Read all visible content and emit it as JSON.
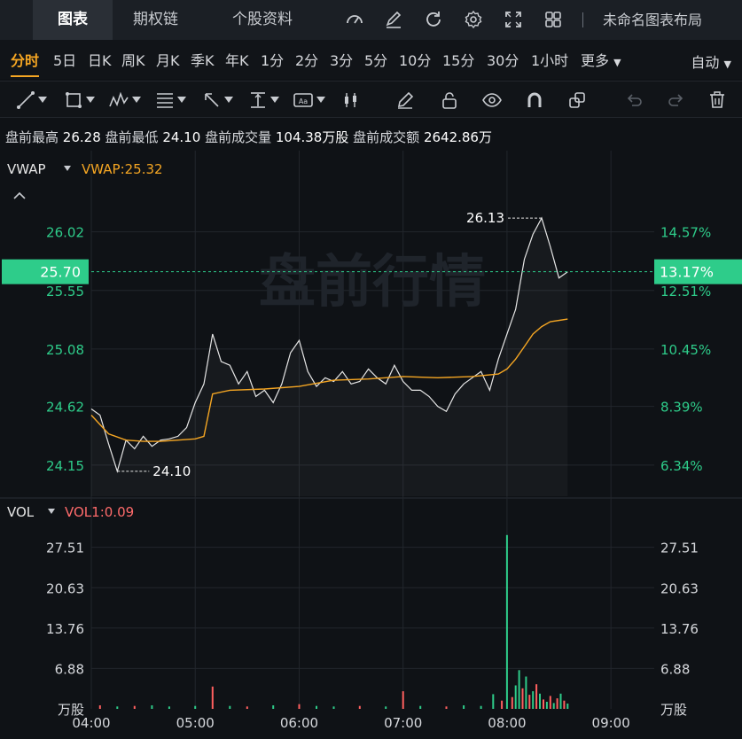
{
  "tabs": [
    {
      "label": "图表",
      "active": true
    },
    {
      "label": "期权链",
      "active": false
    },
    {
      "label": "个股资料",
      "active": false
    }
  ],
  "layout_name": "未命名图表布局",
  "periods": [
    "分时",
    "5日",
    "日K",
    "周K",
    "月K",
    "季K",
    "年K",
    "1分",
    "2分",
    "3分",
    "5分",
    "10分",
    "15分",
    "30分",
    "1小时",
    "更多"
  ],
  "active_period": "分时",
  "auto_label": "自动",
  "info": {
    "high_label": "盘前最高",
    "high_value": "26.28",
    "low_label": "盘前最低",
    "low_value": "24.10",
    "vol_label": "盘前成交量",
    "vol_value": "104.38万股",
    "amt_label": "盘前成交额",
    "amt_value": "2642.86万"
  },
  "watermark": "盘前行情",
  "colors": {
    "up": "#2ecc8a",
    "down": "#ff5f5f",
    "vwap": "#f5a623",
    "price": "#e6e6e6",
    "price_tag_bg": "#2ecc8a"
  },
  "chart_data": {
    "type": "line",
    "price_panel": {
      "indicator_name": "VWAP",
      "indicator_value": "VWAP:25.32",
      "left_ticks": [
        "26.02",
        "25.55",
        "25.08",
        "24.62",
        "24.15"
      ],
      "right_ticks": [
        "14.57%",
        "12.51%",
        "10.45%",
        "8.39%",
        "6.34%"
      ],
      "current_price": "25.70",
      "current_pct": "13.17%",
      "high_annotation": "26.13",
      "low_annotation": "24.10",
      "ylim": [
        23.9,
        26.6
      ],
      "price_series": [
        [
          "04:00",
          24.6
        ],
        [
          "04:05",
          24.55
        ],
        [
          "04:10",
          24.32
        ],
        [
          "04:15",
          24.1
        ],
        [
          "04:20",
          24.35
        ],
        [
          "04:25",
          24.28
        ],
        [
          "04:30",
          24.38
        ],
        [
          "04:35",
          24.3
        ],
        [
          "04:40",
          24.35
        ],
        [
          "04:45",
          24.36
        ],
        [
          "04:50",
          24.38
        ],
        [
          "04:55",
          24.45
        ],
        [
          "05:00",
          24.65
        ],
        [
          "05:05",
          24.8
        ],
        [
          "05:10",
          25.2
        ],
        [
          "05:15",
          24.98
        ],
        [
          "05:20",
          24.95
        ],
        [
          "05:25",
          24.8
        ],
        [
          "05:30",
          24.9
        ],
        [
          "05:35",
          24.7
        ],
        [
          "05:40",
          24.75
        ],
        [
          "05:45",
          24.65
        ],
        [
          "05:50",
          24.8
        ],
        [
          "05:55",
          25.05
        ],
        [
          "06:00",
          25.15
        ],
        [
          "06:05",
          24.9
        ],
        [
          "06:10",
          24.78
        ],
        [
          "06:15",
          24.85
        ],
        [
          "06:20",
          24.82
        ],
        [
          "06:25",
          24.9
        ],
        [
          "06:30",
          24.8
        ],
        [
          "06:35",
          24.82
        ],
        [
          "06:40",
          24.92
        ],
        [
          "06:45",
          24.85
        ],
        [
          "06:50",
          24.8
        ],
        [
          "06:55",
          24.95
        ],
        [
          "07:00",
          24.82
        ],
        [
          "07:05",
          24.75
        ],
        [
          "07:10",
          24.75
        ],
        [
          "07:15",
          24.7
        ],
        [
          "07:20",
          24.62
        ],
        [
          "07:25",
          24.58
        ],
        [
          "07:30",
          24.72
        ],
        [
          "07:35",
          24.8
        ],
        [
          "07:40",
          24.85
        ],
        [
          "07:45",
          24.9
        ],
        [
          "07:50",
          24.75
        ],
        [
          "07:55",
          25.0
        ],
        [
          "08:00",
          25.2
        ],
        [
          "08:05",
          25.4
        ],
        [
          "08:10",
          25.8
        ],
        [
          "08:15",
          26.0
        ],
        [
          "08:20",
          26.13
        ],
        [
          "08:25",
          25.9
        ],
        [
          "08:30",
          25.65
        ],
        [
          "08:35",
          25.7
        ]
      ],
      "vwap_series": [
        [
          "04:00",
          24.55
        ],
        [
          "04:10",
          24.4
        ],
        [
          "04:20",
          24.35
        ],
        [
          "04:30",
          24.34
        ],
        [
          "04:40",
          24.34
        ],
        [
          "04:50",
          24.35
        ],
        [
          "05:00",
          24.36
        ],
        [
          "05:05",
          24.38
        ],
        [
          "05:10",
          24.72
        ],
        [
          "05:20",
          24.75
        ],
        [
          "05:40",
          24.76
        ],
        [
          "06:00",
          24.78
        ],
        [
          "06:20",
          24.83
        ],
        [
          "06:40",
          24.84
        ],
        [
          "07:00",
          24.86
        ],
        [
          "07:20",
          24.85
        ],
        [
          "07:40",
          24.86
        ],
        [
          "07:55",
          24.88
        ],
        [
          "08:00",
          24.92
        ],
        [
          "08:05",
          25.0
        ],
        [
          "08:10",
          25.1
        ],
        [
          "08:15",
          25.2
        ],
        [
          "08:20",
          25.26
        ],
        [
          "08:25",
          25.3
        ],
        [
          "08:35",
          25.32
        ]
      ]
    },
    "volume_panel": {
      "indicator_name": "VOL",
      "indicator_value": "VOL1:0.09",
      "ticks": [
        "27.51",
        "20.63",
        "13.76",
        "6.88"
      ],
      "unit": "万股",
      "ylim": [
        0,
        34.4
      ],
      "bars": [
        [
          "04:05",
          0.6,
          "down"
        ],
        [
          "04:15",
          0.4,
          "up"
        ],
        [
          "04:25",
          0.5,
          "down"
        ],
        [
          "04:35",
          0.6,
          "up"
        ],
        [
          "04:45",
          0.4,
          "up"
        ],
        [
          "05:00",
          0.5,
          "up"
        ],
        [
          "05:10",
          3.8,
          "down"
        ],
        [
          "05:20",
          0.5,
          "up"
        ],
        [
          "05:30",
          0.4,
          "down"
        ],
        [
          "05:45",
          0.6,
          "up"
        ],
        [
          "06:00",
          0.8,
          "down"
        ],
        [
          "06:10",
          0.5,
          "up"
        ],
        [
          "06:20",
          0.4,
          "up"
        ],
        [
          "06:35",
          0.5,
          "down"
        ],
        [
          "06:50",
          0.4,
          "up"
        ],
        [
          "07:00",
          3.0,
          "down"
        ],
        [
          "07:10",
          0.5,
          "up"
        ],
        [
          "07:25",
          0.4,
          "down"
        ],
        [
          "07:35",
          0.6,
          "up"
        ],
        [
          "07:45",
          0.5,
          "up"
        ],
        [
          "07:52",
          2.5,
          "up"
        ],
        [
          "07:57",
          1.4,
          "down"
        ],
        [
          "08:00",
          29.6,
          "up"
        ],
        [
          "08:03",
          2.0,
          "down"
        ],
        [
          "08:05",
          4.0,
          "up"
        ],
        [
          "08:07",
          6.6,
          "up"
        ],
        [
          "08:09",
          3.5,
          "down"
        ],
        [
          "08:11",
          5.5,
          "up"
        ],
        [
          "08:13",
          2.4,
          "down"
        ],
        [
          "08:15",
          3.0,
          "up"
        ],
        [
          "08:17",
          4.2,
          "down"
        ],
        [
          "08:19",
          2.6,
          "up"
        ],
        [
          "08:21",
          1.6,
          "down"
        ],
        [
          "08:23",
          1.2,
          "up"
        ],
        [
          "08:25",
          2.2,
          "down"
        ],
        [
          "08:27",
          1.0,
          "up"
        ],
        [
          "08:29",
          1.8,
          "down"
        ],
        [
          "08:31",
          2.6,
          "up"
        ],
        [
          "08:33",
          1.4,
          "down"
        ],
        [
          "08:35",
          0.9,
          "up"
        ]
      ]
    },
    "x_ticks": [
      "04:00",
      "05:00",
      "06:00",
      "07:00",
      "08:00",
      "09:00"
    ],
    "xlim": [
      "04:00",
      "09:25"
    ]
  }
}
